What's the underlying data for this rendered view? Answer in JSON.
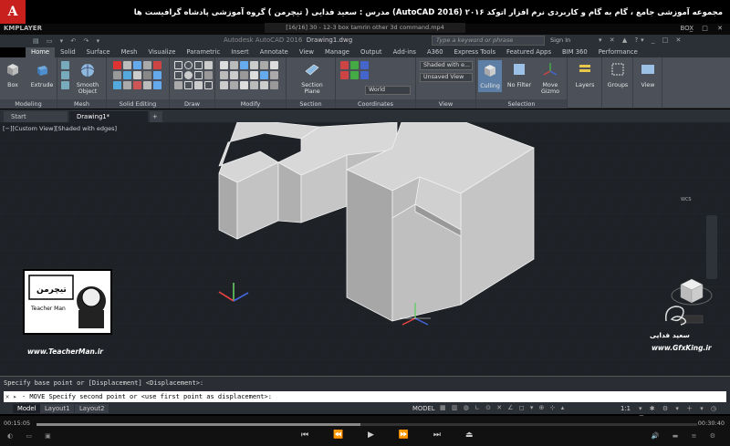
{
  "banner": {
    "title": "مجموعه آموزشی جامع ، گام به گام و کاربردی نرم افزار  اتوکد ۲۰۱۶ (AutoCAD 2016)   مدرس : سعید فدایی ( تیچرمن ) گروه آموزشی پادشاه گرافیست ها"
  },
  "player": {
    "brand": "KMPLAYER",
    "file": "[16/16] 30 - 12-3 box tamrin  other 3d command.mp4",
    "box_label": "BOX",
    "time_elapsed": "00:15:05",
    "time_total": "00:30:40",
    "progress": 0.49
  },
  "app": {
    "logo": "A",
    "title": "Autodesk AutoCAD 2016",
    "doc": "Drawing1.dwg",
    "search_placeholder": "Type a keyword or phrase",
    "signin": "Sign In"
  },
  "ribbon_tabs": [
    "Home",
    "Solid",
    "Surface",
    "Mesh",
    "Visualize",
    "Parametric",
    "Insert",
    "Annotate",
    "View",
    "Manage",
    "Output",
    "Add-ins",
    "A360",
    "Express Tools",
    "Featured Apps",
    "BIM 360",
    "Performance"
  ],
  "ribbon": {
    "modeling": {
      "title": "Modeling",
      "box": "Box",
      "extrude": "Extrude"
    },
    "mesh": {
      "title": "Mesh",
      "smooth": "Smooth Object"
    },
    "solid_editing": {
      "title": "Solid Editing"
    },
    "draw": {
      "title": "Draw"
    },
    "modify": {
      "title": "Modify"
    },
    "section": {
      "title": "Section",
      "plane": "Section Plane"
    },
    "coordinates": {
      "title": "Coordinates",
      "world": "World"
    },
    "view": {
      "title": "View",
      "visual_style": "Shaded with e...",
      "saved_view": "Unsaved View"
    },
    "selection": {
      "title": "Selection",
      "culling": "Culling",
      "nofilter": "No Filter",
      "gizmo": "Move Gizmo"
    },
    "layers": {
      "label": "Layers"
    },
    "groups": {
      "label": "Groups"
    },
    "viewbtn": {
      "label": "View"
    }
  },
  "doc_tabs": {
    "start": "Start",
    "drawing": "Drawing1*",
    "add": "+"
  },
  "viewport": {
    "label": "[−][Custom View][Shaded with edges]",
    "wcs": "WCS"
  },
  "command": {
    "history": "Specify base point or [Displacement] <Displacement>:",
    "prompt": "- MOVE Specify second point or <use first point as displacement>:"
  },
  "layouts": [
    "Model",
    "Layout1",
    "Layout2"
  ],
  "status": {
    "model": "MODEL",
    "scale": "1:1"
  },
  "watermarks": {
    "left_brand": "تیچرمن",
    "left_sub": "Teacher Man",
    "left_url": "www.TeacherMan.ir",
    "right_name": "سعید فدایی",
    "right_url": "www.GfxKing.ir"
  },
  "colors": {
    "ribbon_bg": "#4b5059",
    "viewport_bg": "#1e2227",
    "acad_red": "#c8201d",
    "solid_face_top": "#d9d9d9",
    "solid_face_left": "#b4b4b4",
    "solid_face_right": "#c8c8c8"
  }
}
